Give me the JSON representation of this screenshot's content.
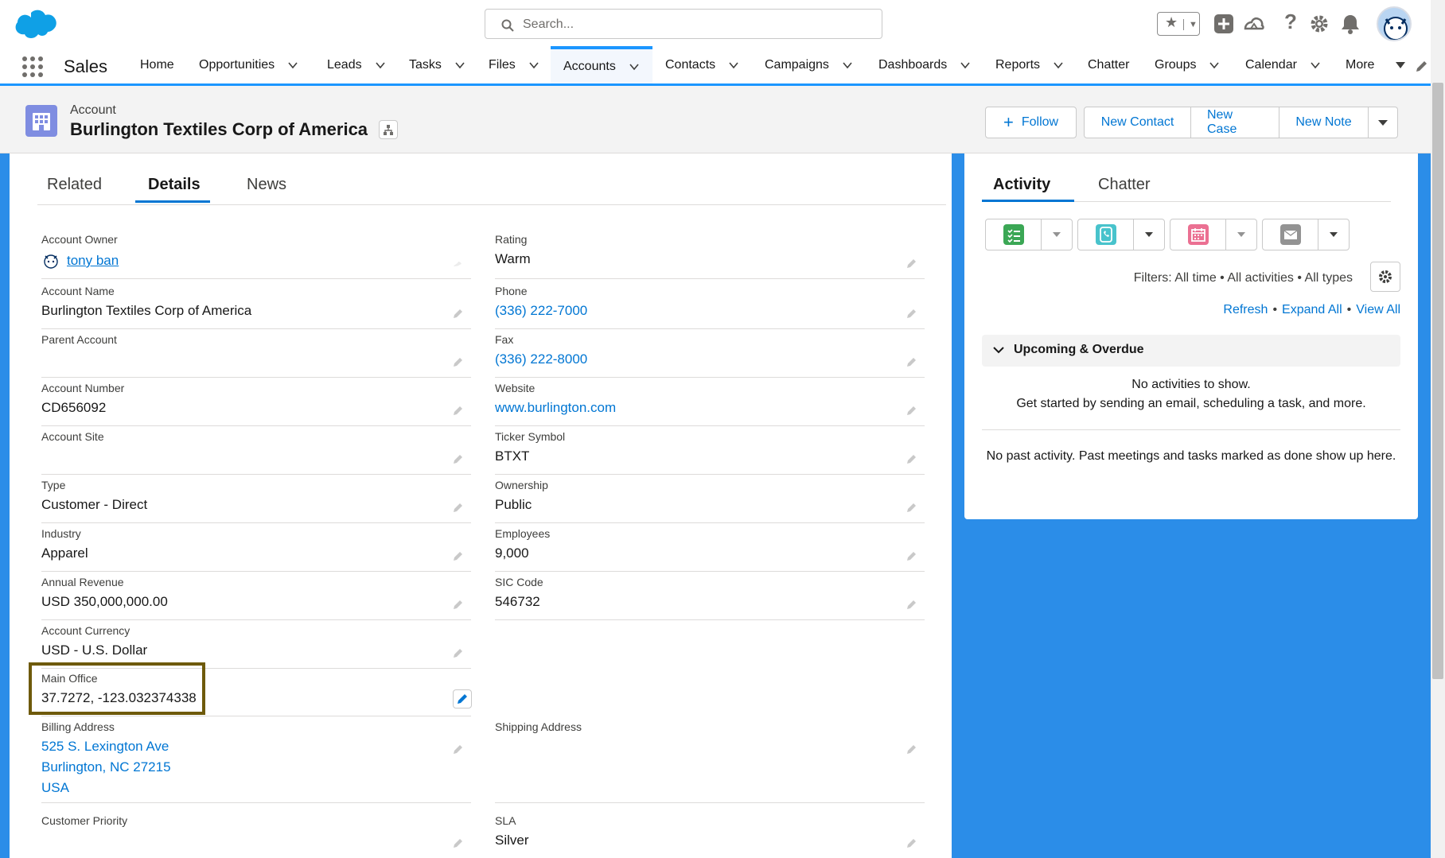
{
  "search": {
    "placeholder": "Search..."
  },
  "app": {
    "name": "Sales"
  },
  "nav": {
    "items": [
      {
        "label": "Home",
        "has_menu": false
      },
      {
        "label": "Opportunities",
        "has_menu": true
      },
      {
        "label": "Leads",
        "has_menu": true
      },
      {
        "label": "Tasks",
        "has_menu": true
      },
      {
        "label": "Files",
        "has_menu": true
      },
      {
        "label": "Accounts",
        "has_menu": true,
        "active": true
      },
      {
        "label": "Contacts",
        "has_menu": true
      },
      {
        "label": "Campaigns",
        "has_menu": true
      },
      {
        "label": "Dashboards",
        "has_menu": true
      },
      {
        "label": "Reports",
        "has_menu": true
      },
      {
        "label": "Chatter",
        "has_menu": false
      },
      {
        "label": "Groups",
        "has_menu": true
      },
      {
        "label": "Calendar",
        "has_menu": true
      },
      {
        "label": "More",
        "has_menu": true
      }
    ]
  },
  "record": {
    "type": "Account",
    "title": "Burlington Textiles Corp of America",
    "actions": {
      "follow": "Follow",
      "new_contact": "New Contact",
      "new_case": "New Case",
      "new_note": "New Note"
    }
  },
  "tabs": {
    "related": "Related",
    "details": "Details",
    "news": "News"
  },
  "fields": {
    "account_owner": {
      "label": "Account Owner",
      "value": "tony ban"
    },
    "rating": {
      "label": "Rating",
      "value": "Warm"
    },
    "account_name": {
      "label": "Account Name",
      "value": "Burlington Textiles Corp of America"
    },
    "phone": {
      "label": "Phone",
      "value": "(336) 222-7000"
    },
    "parent_account": {
      "label": "Parent Account",
      "value": ""
    },
    "fax": {
      "label": "Fax",
      "value": "(336) 222-8000"
    },
    "account_number": {
      "label": "Account Number",
      "value": "CD656092"
    },
    "website": {
      "label": "Website",
      "value": "www.burlington.com"
    },
    "account_site": {
      "label": "Account Site",
      "value": ""
    },
    "ticker": {
      "label": "Ticker Symbol",
      "value": "BTXT"
    },
    "type": {
      "label": "Type",
      "value": "Customer - Direct"
    },
    "ownership": {
      "label": "Ownership",
      "value": "Public"
    },
    "industry": {
      "label": "Industry",
      "value": "Apparel"
    },
    "employees": {
      "label": "Employees",
      "value": "9,000"
    },
    "annual_revenue": {
      "label": "Annual Revenue",
      "value": "USD 350,000,000.00"
    },
    "sic_code": {
      "label": "SIC Code",
      "value": "546732"
    },
    "account_currency": {
      "label": "Account Currency",
      "value": "USD - U.S. Dollar"
    },
    "main_office": {
      "label": "Main Office",
      "value": "37.7272, -123.032374338"
    },
    "billing_address": {
      "label": "Billing Address",
      "line1": "525 S. Lexington Ave",
      "line2": "Burlington, NC 27215",
      "line3": "USA"
    },
    "shipping_address": {
      "label": "Shipping Address",
      "value": ""
    },
    "customer_priority": {
      "label": "Customer Priority",
      "value": ""
    },
    "sla": {
      "label": "SLA",
      "value": "Silver"
    }
  },
  "activity": {
    "tabs": {
      "activity": "Activity",
      "chatter": "Chatter"
    },
    "filters": "Filters: All time • All activities • All types",
    "links": {
      "refresh": "Refresh",
      "expand_all": "Expand All",
      "view_all": "View All",
      "sep": "•"
    },
    "upcoming_title": "Upcoming & Overdue",
    "empty_line1": "No activities to show.",
    "empty_line2": "Get started by sending an email, scheduling a task, and more.",
    "past": "No past activity. Past meetings and tasks marked as done show up here."
  },
  "colors": {
    "brand": "#0176d3",
    "nav_active": "#1b96ff",
    "background": "#2b8de8",
    "account_icon": "#7f8de1",
    "task_icon": "#3ba755",
    "call_icon": "#48c3cc",
    "event_icon": "#eb7092",
    "email_icon": "#939393",
    "highlight_border": "#6e5a0a"
  },
  "icons": [
    "salesforce-cloud-logo",
    "search-icon",
    "star-icon",
    "add-icon",
    "trailhead-icon",
    "help-icon",
    "gear-icon",
    "bell-icon",
    "app-launcher-icon",
    "pencil-icon",
    "hierarchy-icon"
  ]
}
